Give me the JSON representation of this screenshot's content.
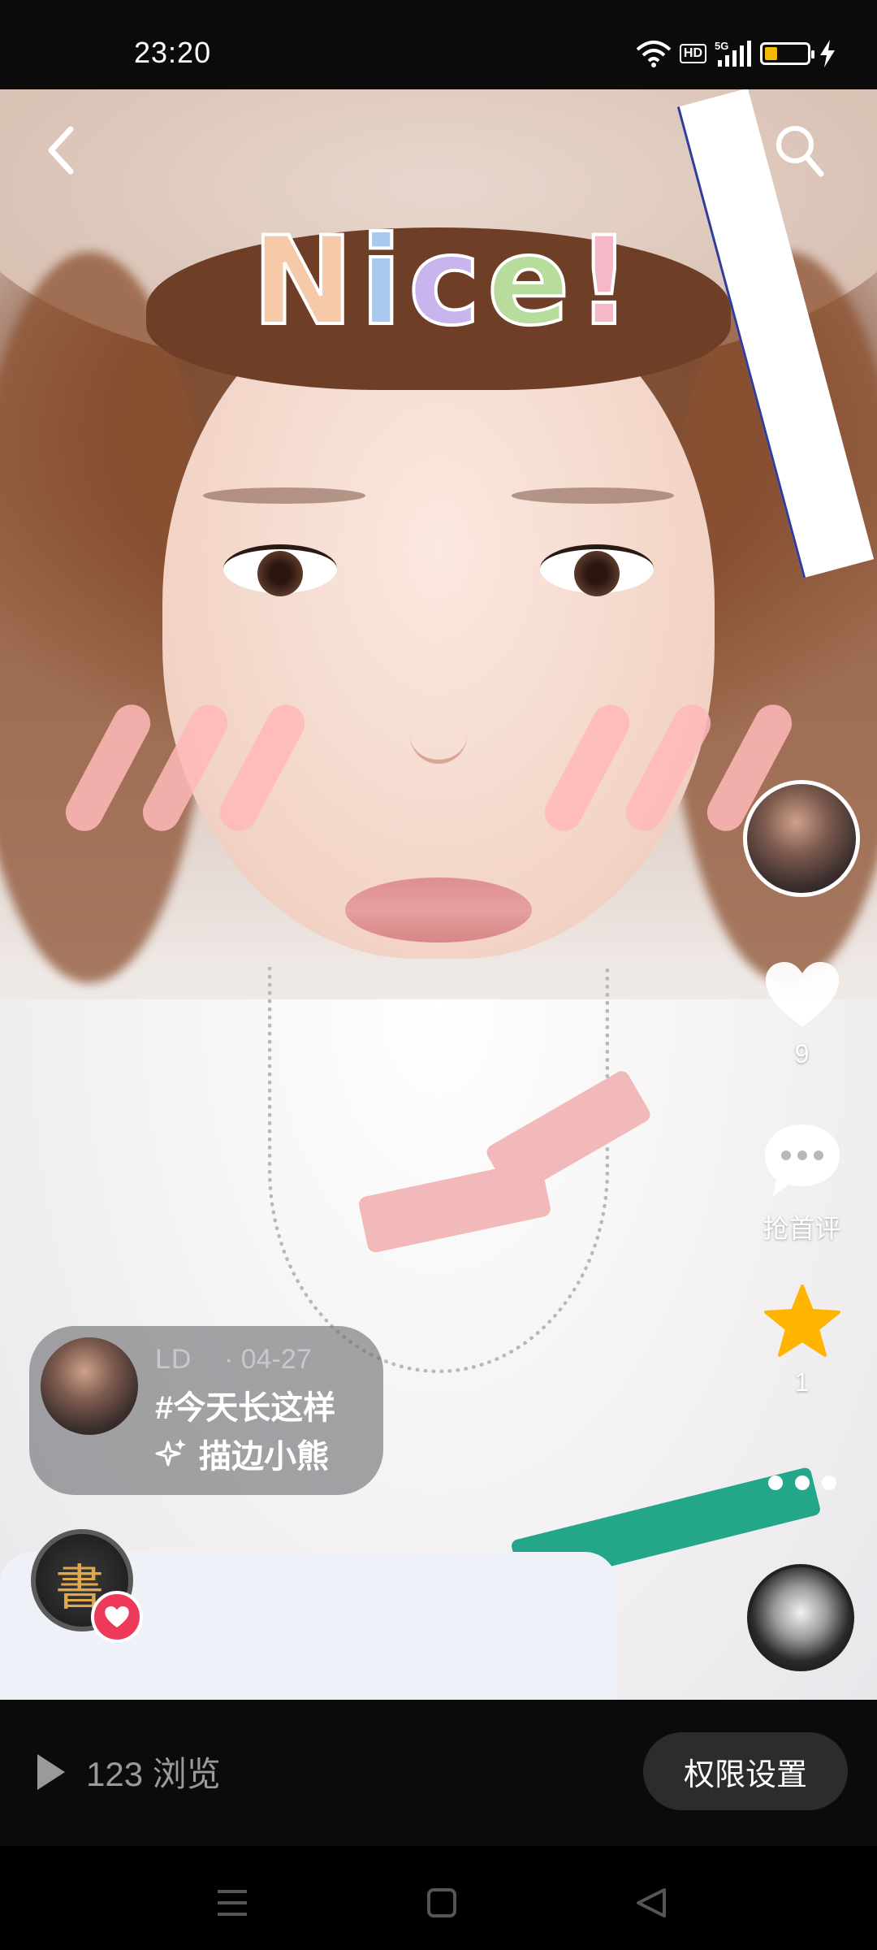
{
  "status_bar": {
    "time": "23:20",
    "network_badge": "HD",
    "network_type": "5G",
    "battery_level_fraction": 0.3,
    "battery_color": "#f5b800",
    "icons": [
      "wifi-icon",
      "hd-icon",
      "signal-5g-icon",
      "battery-icon",
      "charging-icon"
    ]
  },
  "photo": {
    "sticker_text": [
      "N",
      "i",
      "c",
      "e",
      "!"
    ]
  },
  "top_bar": {
    "icons": [
      "back-arrow-icon",
      "search-icon"
    ]
  },
  "sidebar": {
    "like_count": "9",
    "comment_label": "抢首评",
    "favorite_count": "1",
    "icons": [
      "heart-icon",
      "comment-icon",
      "star-icon",
      "more-icon",
      "music-disc-icon"
    ],
    "star_color": "#ffb400"
  },
  "post_info": {
    "author": "LD",
    "date": "· 04-27",
    "title": "#今天长这样",
    "effect": "描边小熊",
    "effect_icon": "sparkle-icon"
  },
  "music": {
    "badge_color": "#ee3a5a",
    "glyph": "書"
  },
  "bottom_bar": {
    "views": "123 浏览",
    "permission_button": "权限设置"
  },
  "nav_bar": {
    "icons": [
      "menu-nav-icon",
      "home-nav-icon",
      "back-nav-icon"
    ]
  }
}
